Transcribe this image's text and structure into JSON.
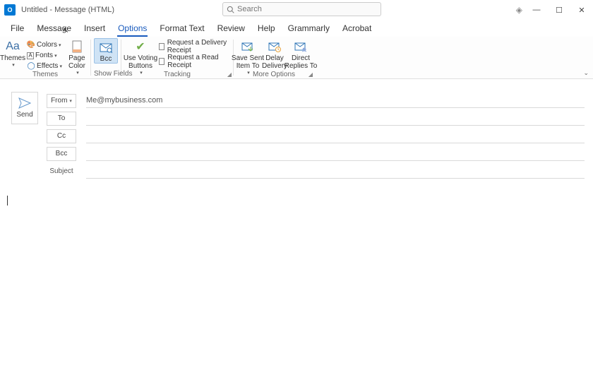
{
  "titlebar": {
    "app_initial": "O",
    "title": "Untitled  -  Message (HTML)",
    "search_placeholder": "Search"
  },
  "win": {
    "min": "—",
    "max": "☐",
    "close": "✕"
  },
  "menu": {
    "file": "File",
    "message": "Message",
    "insert": "Insert",
    "options": "Options",
    "format_text": "Format Text",
    "review": "Review",
    "help": "Help",
    "grammarly": "Grammarly",
    "acrobat": "Acrobat"
  },
  "ribbon": {
    "themes_group": "Themes",
    "themes_btn": "Themes",
    "colors": "Colors",
    "fonts": "Fonts",
    "effects": "Effects",
    "page_color": "Page\nColor",
    "bcc_btn": "Bcc",
    "show_fields_group": "Show Fields",
    "use_voting": "Use Voting\nButtons",
    "req_delivery": "Request a Delivery Receipt",
    "req_read": "Request a Read Receipt",
    "tracking_group": "Tracking",
    "save_sent": "Save Sent\nItem To",
    "delay": "Delay\nDelivery",
    "direct": "Direct\nReplies To",
    "more_options_group": "More Options"
  },
  "compose": {
    "send": "Send",
    "from_label": "From",
    "from_value": "Me@mybusiness.com",
    "to": "To",
    "cc": "Cc",
    "bcc": "Bcc",
    "subject": "Subject"
  }
}
